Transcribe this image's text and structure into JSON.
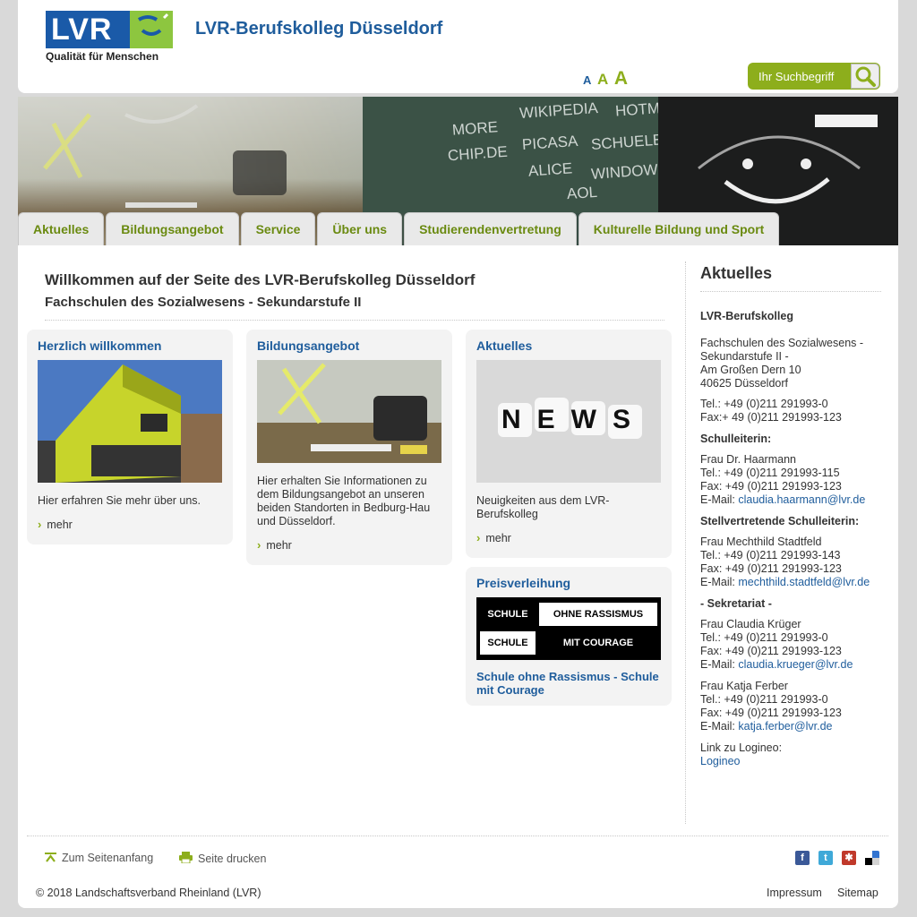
{
  "header": {
    "logo_text": "LVR",
    "logo_tagline": "Qualität für Menschen",
    "site_title": "LVR-Berufskolleg Düsseldorf",
    "font_sizes": [
      "A",
      "A",
      "A"
    ],
    "search_placeholder": "Ihr Suchbegriff"
  },
  "nav": {
    "tabs": [
      {
        "label": "Aktuelles"
      },
      {
        "label": "Bildungsangebot"
      },
      {
        "label": "Service"
      },
      {
        "label": "Über uns"
      },
      {
        "label": "Studierendenvertretung"
      },
      {
        "label": "Kulturelle Bildung und Sport"
      }
    ]
  },
  "banner": {
    "chalk_words": [
      "WIKIPEDIA",
      "HOTMAIL",
      "PICASA",
      "SCHUELERVZ",
      "ALICE",
      "WINDOWS",
      "AOL",
      "CHIP.DE",
      "MORE"
    ]
  },
  "main": {
    "title": "Willkommen auf der Seite des LVR-Berufskolleg Düsseldorf",
    "subtitle": "Fachschulen des Sozialwesens - Sekundarstufe II",
    "cards": [
      {
        "title": "Herzlich willkommen",
        "text": "Hier erfahren Sie mehr über uns.",
        "more": "mehr"
      },
      {
        "title": "Bildungsangebot",
        "text": "Hier erhalten Sie Informationen zu dem Bildungsangebot an unseren beiden Standorten in Bedburg-Hau und Düsseldorf.",
        "more": "mehr"
      },
      {
        "title": "Aktuelles",
        "text": "Neuigkeiten aus dem LVR-Berufskolleg",
        "more": "mehr",
        "image_word": "NEWS"
      },
      {
        "title": "Preisverleihung",
        "badge_lines": [
          [
            "SCHULE",
            "OHNE RASSISMUS"
          ],
          [
            "SCHULE",
            "MIT COURAGE"
          ]
        ],
        "link": "Schule ohne Rassismus - Schule mit Courage"
      }
    ]
  },
  "sidebar": {
    "title": "Aktuelles",
    "org": "LVR-Berufskolleg",
    "address": [
      "Fachschulen des Sozialwesens -",
      "Sekundarstufe II -",
      "Am Großen Dern 10",
      "40625 Düsseldorf"
    ],
    "phone": "Tel.: +49 (0)211 291993-0",
    "fax": "Fax:+ 49 (0)211 291993-123",
    "sections": [
      {
        "heading": "Schulleiterin:",
        "name": "Frau Dr. Haarmann",
        "tel": "Tel.: +49 (0)211 291993-115",
        "fax": "Fax: +49 (0)211 291993-123",
        "email_label": "E-Mail: ",
        "email": "claudia.haarmann@lvr.de"
      },
      {
        "heading": "Stellvertretende Schulleiterin:",
        "name": "Frau Mechthild Stadtfeld",
        "tel": "Tel.: +49 (0)211 291993-143",
        "fax": "Fax: +49 (0)211 291993-123",
        "email_label": "E-Mail: ",
        "email": "mechthild.stadtfeld@lvr.de"
      },
      {
        "heading": "- Sekretariat -",
        "name": "Frau Claudia Krüger",
        "tel": "Tel.: +49 (0)211 291993-0",
        "fax": "Fax: +49 (0)211 291993-123",
        "email_label": "E-Mail: ",
        "email": "claudia.krueger@lvr.de"
      },
      {
        "heading": "",
        "name": "Frau Katja Ferber",
        "tel": "Tel.: +49 (0)211 291993-0",
        "fax": "Fax: +49 (0)211 291993-123",
        "email_label": "E-Mail: ",
        "email": "katja.ferber@lvr.de"
      }
    ],
    "logineo_label": "Link zu Logineo:",
    "logineo_link": "Logineo"
  },
  "footer": {
    "to_top": "Zum Seitenanfang",
    "print": "Seite drucken",
    "social": [
      {
        "name": "facebook-icon",
        "glyph": "f",
        "color": "#3b5998"
      },
      {
        "name": "twitter-icon",
        "glyph": "t",
        "color": "#3fa9d8"
      },
      {
        "name": "mister-wong-icon",
        "glyph": "✱",
        "color": "#c0392b"
      },
      {
        "name": "delicious-icon",
        "glyph": "",
        "color": "#3274d1"
      }
    ],
    "copyright": "© 2018 Landschaftsverband Rheinland (LVR)",
    "impressum": "Impressum",
    "sitemap": "Sitemap"
  },
  "colors": {
    "brand_blue": "#1f5d9c",
    "brand_green": "#8dae1c"
  }
}
